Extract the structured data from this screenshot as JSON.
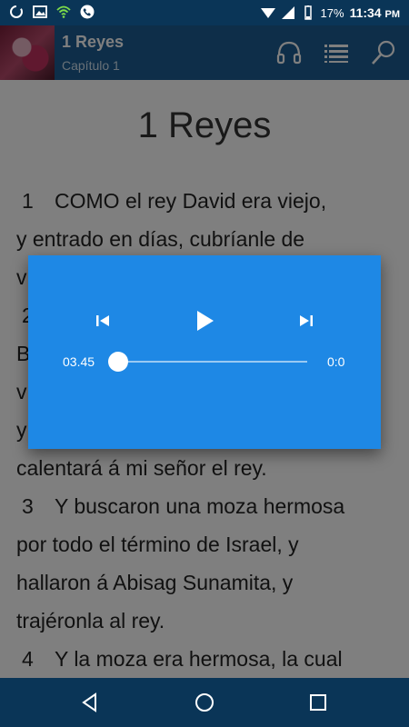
{
  "status_bar": {
    "battery_percent": "17%",
    "time": "11:34",
    "ampm": "PM"
  },
  "app_bar": {
    "title": "1 Reyes",
    "subtitle": "Capítulo 1"
  },
  "content": {
    "book_title": "1 Reyes",
    "verse_lines": [
      "COMO el rey David era viejo,",
      "y entrado en días, cubríanle de",
      "v",
      "2",
      "B",
      "v",
      "y",
      "calentará á mi señor el rey.",
      "Y buscaron una moza hermosa",
      "por todo el término de Israel, y",
      "hallaron á Abisag Sunamita, y",
      "trajéronla al rey.",
      "Y la moza era hermosa, la cual"
    ],
    "verse_numbers": {
      "v1": "1",
      "v3": "3",
      "v4": "4"
    }
  },
  "player": {
    "current_time": "03.45",
    "total_time": "0:0",
    "progress": 0.0
  },
  "icons": {
    "headphones": "headphones-icon",
    "chapters": "list-icon",
    "search": "search-icon"
  }
}
